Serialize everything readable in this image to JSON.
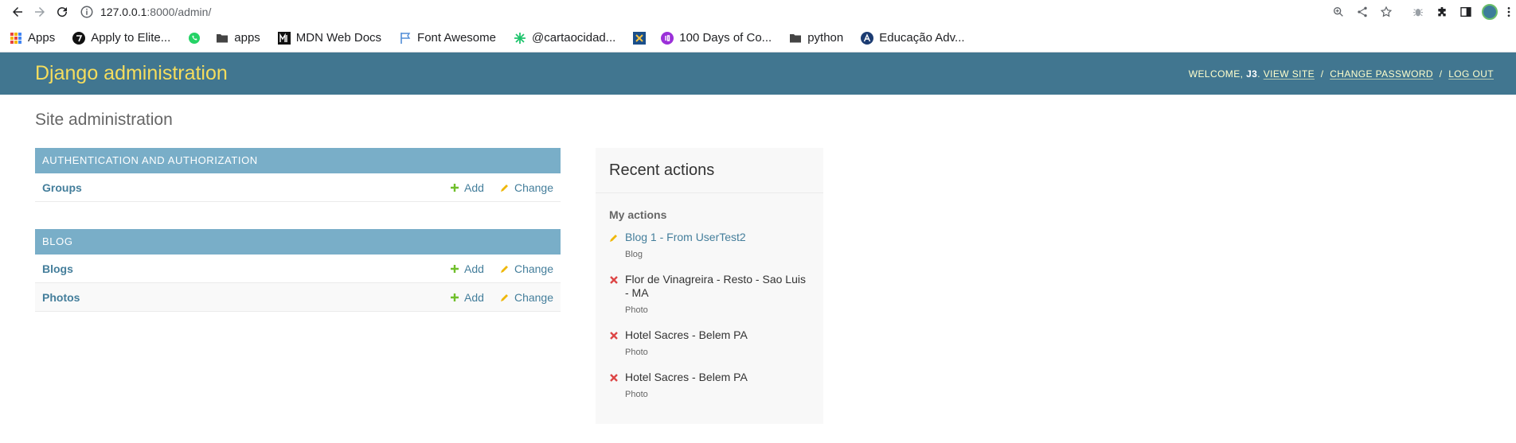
{
  "browser": {
    "url_host": "127.0.0.1",
    "url_rest": ":8000/admin/",
    "bookmarks": [
      {
        "label": "Apps",
        "icon": "apps-grid-icon"
      },
      {
        "label": "Apply to Elite...",
        "icon": "site-favicon-icon"
      },
      {
        "label": "",
        "icon": "whatsapp-icon"
      },
      {
        "label": "apps",
        "icon": "folder-icon"
      },
      {
        "label": "MDN Web Docs",
        "icon": "mdn-icon"
      },
      {
        "label": "Font Awesome",
        "icon": "flag-icon"
      },
      {
        "label": "@cartaocidad...",
        "icon": "spark-icon"
      },
      {
        "label": "",
        "icon": "site-favicon-icon"
      },
      {
        "label": "100 Days of Co...",
        "icon": "site-favicon-icon"
      },
      {
        "label": "python",
        "icon": "folder-icon"
      },
      {
        "label": "Educação Adv...",
        "icon": "site-favicon-icon"
      }
    ]
  },
  "header": {
    "branding": "Django administration",
    "welcome": "WELCOME, ",
    "username": "J3",
    "view_site": "VIEW SITE",
    "change_password": "CHANGE PASSWORD",
    "log_out": "LOG OUT",
    "sep": "/"
  },
  "page": {
    "title": "Site administration"
  },
  "modules": [
    {
      "caption": "Authentication and Authorization",
      "models": [
        {
          "name": "Groups",
          "add": "Add",
          "change": "Change"
        }
      ]
    },
    {
      "caption": "Blog",
      "models": [
        {
          "name": "Blogs",
          "add": "Add",
          "change": "Change"
        },
        {
          "name": "Photos",
          "add": "Add",
          "change": "Change"
        }
      ]
    }
  ],
  "recent": {
    "title": "Recent actions",
    "subtitle": "My actions",
    "items": [
      {
        "text": "Blog 1 - From UserTest2",
        "type": "Blog",
        "action": "change",
        "link": true
      },
      {
        "text": "Flor de Vinagreira - Resto - Sao Luis - MA",
        "type": "Photo",
        "action": "delete",
        "link": false
      },
      {
        "text": "Hotel Sacres - Belem PA",
        "type": "Photo",
        "action": "delete",
        "link": false
      },
      {
        "text": "Hotel Sacres - Belem PA",
        "type": "Photo",
        "action": "delete",
        "link": false
      }
    ]
  },
  "colors": {
    "header_bg": "#417690",
    "branding": "#f5dd5d",
    "caption_bg": "#79aec8",
    "link": "#447e9b",
    "add_green": "#70bf2b",
    "change_yellow": "#efb80b",
    "delete_red": "#dd4646"
  }
}
